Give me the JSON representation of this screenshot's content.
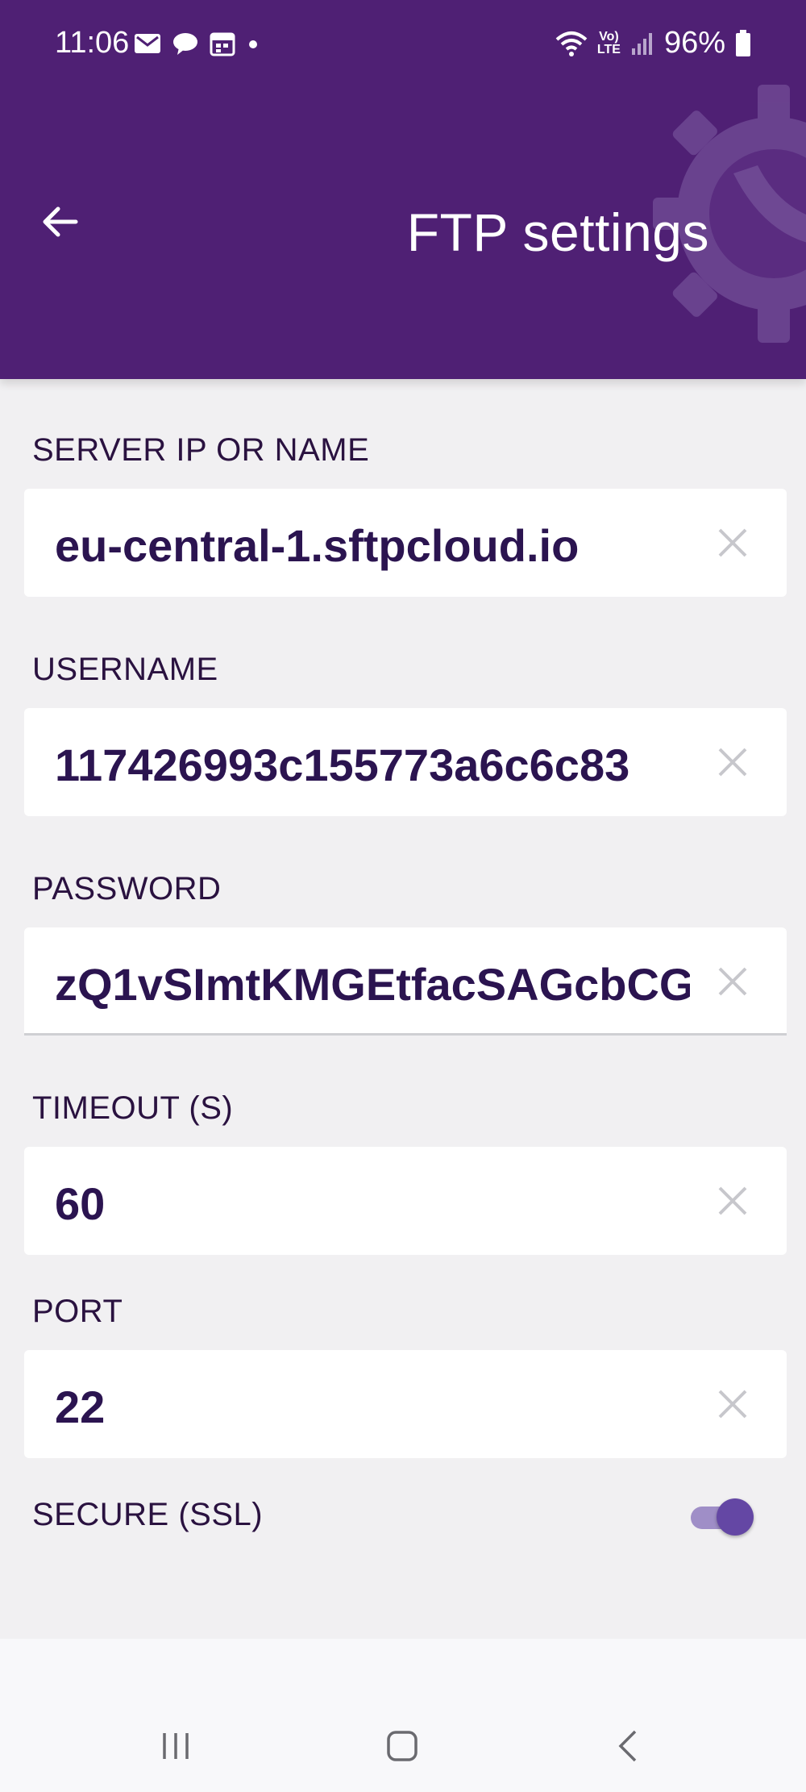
{
  "status_bar": {
    "time": "11:06",
    "battery": "96%",
    "notification_icons": [
      "mail-icon",
      "chat-icon",
      "calendar-icon",
      "dot-icon"
    ],
    "system_icons": [
      "wifi-icon",
      "volte-icon",
      "signal-icon",
      "battery-icon"
    ],
    "volte_label_top": "Vo)",
    "volte_label_bottom": "LTE"
  },
  "header": {
    "title": "FTP settings",
    "color": "#4f2074"
  },
  "fields": {
    "server": {
      "label": "SERVER IP OR NAME",
      "value": "eu-central-1.sftpcloud.io"
    },
    "username": {
      "label": "USERNAME",
      "value": "117426993c155773a6c6c83"
    },
    "password": {
      "label": "PASSWORD",
      "value": "zQ1vSImtKMGEtfacSAGcbCG"
    },
    "timeout": {
      "label": "TIMEOUT (S)",
      "value": "60"
    },
    "port": {
      "label": "PORT",
      "value": "22"
    }
  },
  "secure": {
    "label": "SECURE (SSL)",
    "enabled": true
  },
  "nav": {
    "buttons": [
      "recent-apps",
      "home",
      "back"
    ]
  },
  "colors": {
    "accent": "#6447a4",
    "text_dark": "#2b1450",
    "background": "#f1f0f2"
  }
}
